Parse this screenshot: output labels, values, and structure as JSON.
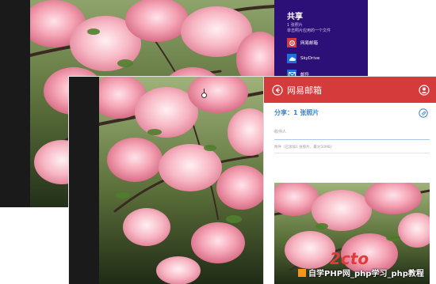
{
  "share_pane": {
    "title": "共享",
    "subtitle_line1": "1 张照片",
    "subtitle_line2": "单击照片应用的一个文件",
    "items": [
      {
        "label": "网易邮箱",
        "icon": "netease-mail-icon",
        "color": "#d63b3b"
      },
      {
        "label": "SkyDrive",
        "icon": "skydrive-icon",
        "color": "#1e6fd9"
      },
      {
        "label": "邮件",
        "icon": "mail-icon",
        "color": "#1e6fd9"
      }
    ]
  },
  "mail_app": {
    "title": "网易邮箱",
    "share_count": "分享：1 张照片",
    "to_placeholder": "收件人",
    "attachment_note": "附件（已添加1 张照片，最大50MB）",
    "accent": "#d63b3b",
    "link_color": "#3d7fc4"
  },
  "watermark": {
    "logo": "2cto",
    "text": "自学PHP网_php学习_php教程"
  }
}
